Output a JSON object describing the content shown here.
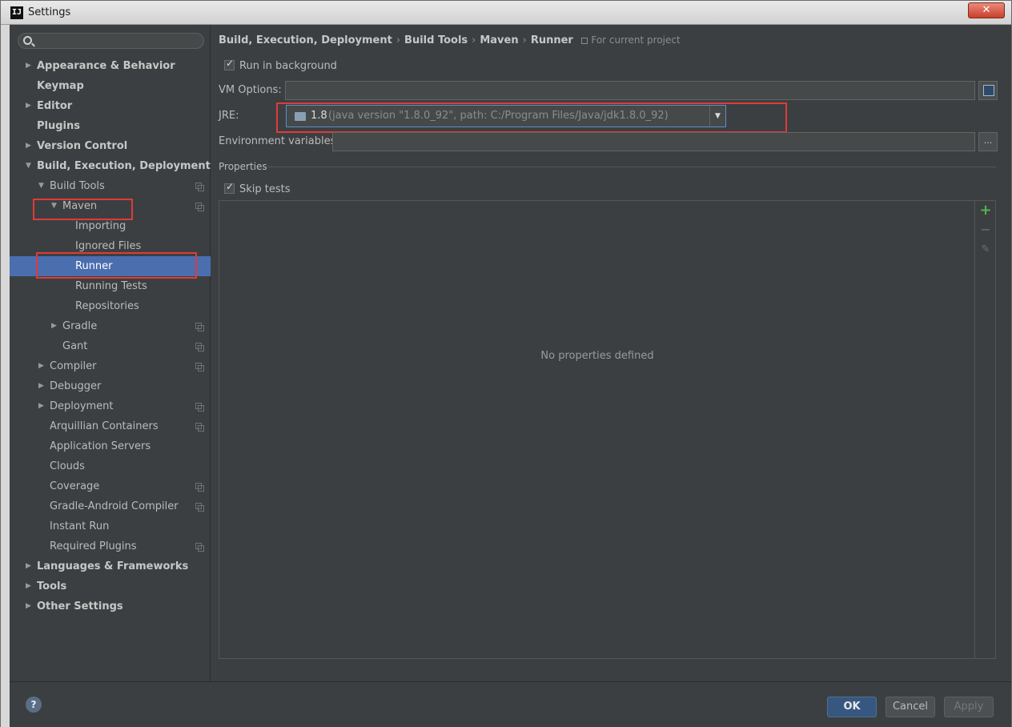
{
  "window": {
    "title": "Settings",
    "app_icon_text": "IJ",
    "close_label": "✕"
  },
  "search": {
    "placeholder": "",
    "value": ""
  },
  "sidebar": {
    "items": [
      {
        "label": "Appearance & Behavior",
        "level": 0,
        "arrow": "right",
        "bold": true
      },
      {
        "label": "Keymap",
        "level": 0,
        "arrow": "",
        "bold": true
      },
      {
        "label": "Editor",
        "level": 0,
        "arrow": "right",
        "bold": true
      },
      {
        "label": "Plugins",
        "level": 0,
        "arrow": "",
        "bold": true
      },
      {
        "label": "Version Control",
        "level": 0,
        "arrow": "right",
        "bold": true
      },
      {
        "label": "Build, Execution, Deployment",
        "level": 0,
        "arrow": "down",
        "bold": true
      },
      {
        "label": "Build Tools",
        "level": 1,
        "arrow": "down",
        "copy": true
      },
      {
        "label": "Maven",
        "level": 2,
        "arrow": "down",
        "copy": true
      },
      {
        "label": "Importing",
        "level": 3,
        "arrow": ""
      },
      {
        "label": "Ignored Files",
        "level": 3,
        "arrow": ""
      },
      {
        "label": "Runner",
        "level": 3,
        "arrow": "",
        "selected": true
      },
      {
        "label": "Running Tests",
        "level": 3,
        "arrow": ""
      },
      {
        "label": "Repositories",
        "level": 3,
        "arrow": ""
      },
      {
        "label": "Gradle",
        "level": 2,
        "arrow": "right",
        "copy": true
      },
      {
        "label": "Gant",
        "level": 2,
        "arrow": "",
        "copy": true
      },
      {
        "label": "Compiler",
        "level": 1,
        "arrow": "right",
        "copy": true
      },
      {
        "label": "Debugger",
        "level": 1,
        "arrow": "right"
      },
      {
        "label": "Deployment",
        "level": 1,
        "arrow": "right",
        "copy": true
      },
      {
        "label": "Arquillian Containers",
        "level": 1,
        "arrow": "",
        "copy": true
      },
      {
        "label": "Application Servers",
        "level": 1,
        "arrow": ""
      },
      {
        "label": "Clouds",
        "level": 1,
        "arrow": ""
      },
      {
        "label": "Coverage",
        "level": 1,
        "arrow": "",
        "copy": true
      },
      {
        "label": "Gradle-Android Compiler",
        "level": 1,
        "arrow": "",
        "copy": true
      },
      {
        "label": "Instant Run",
        "level": 1,
        "arrow": ""
      },
      {
        "label": "Required Plugins",
        "level": 1,
        "arrow": "",
        "copy": true
      },
      {
        "label": "Languages & Frameworks",
        "level": 0,
        "arrow": "right",
        "bold": true
      },
      {
        "label": "Tools",
        "level": 0,
        "arrow": "right",
        "bold": true
      },
      {
        "label": "Other Settings",
        "level": 0,
        "arrow": "right",
        "bold": true
      }
    ]
  },
  "breadcrumb": {
    "parts": [
      "Build, Execution, Deployment",
      "Build Tools",
      "Maven",
      "Runner"
    ],
    "separator": "›",
    "scope": "For current project"
  },
  "runner": {
    "run_in_background": {
      "label": "Run in background",
      "checked": true
    },
    "vm_options": {
      "label": "VM Options:",
      "value": ""
    },
    "jre": {
      "label": "JRE:",
      "version": "1.8",
      "detail": "(java version \"1.8.0_92\", path: C:/Program Files/Java/jdk1.8.0_92)"
    },
    "env_vars": {
      "label": "Environment variables:",
      "value": "",
      "button": "..."
    },
    "properties": {
      "section_title": "Properties"
    },
    "skip_tests": {
      "label": "Skip tests",
      "checked": true
    },
    "props_empty": "No properties defined",
    "toolbar": {
      "add": "+",
      "remove": "−",
      "edit": "✎"
    }
  },
  "footer": {
    "help": "?",
    "ok": "OK",
    "cancel": "Cancel",
    "apply": "Apply"
  },
  "colors": {
    "selection": "#4b6eaf",
    "highlight": "#e03a3a",
    "ok_button": "#365880",
    "add_icon": "#4fb64f"
  }
}
